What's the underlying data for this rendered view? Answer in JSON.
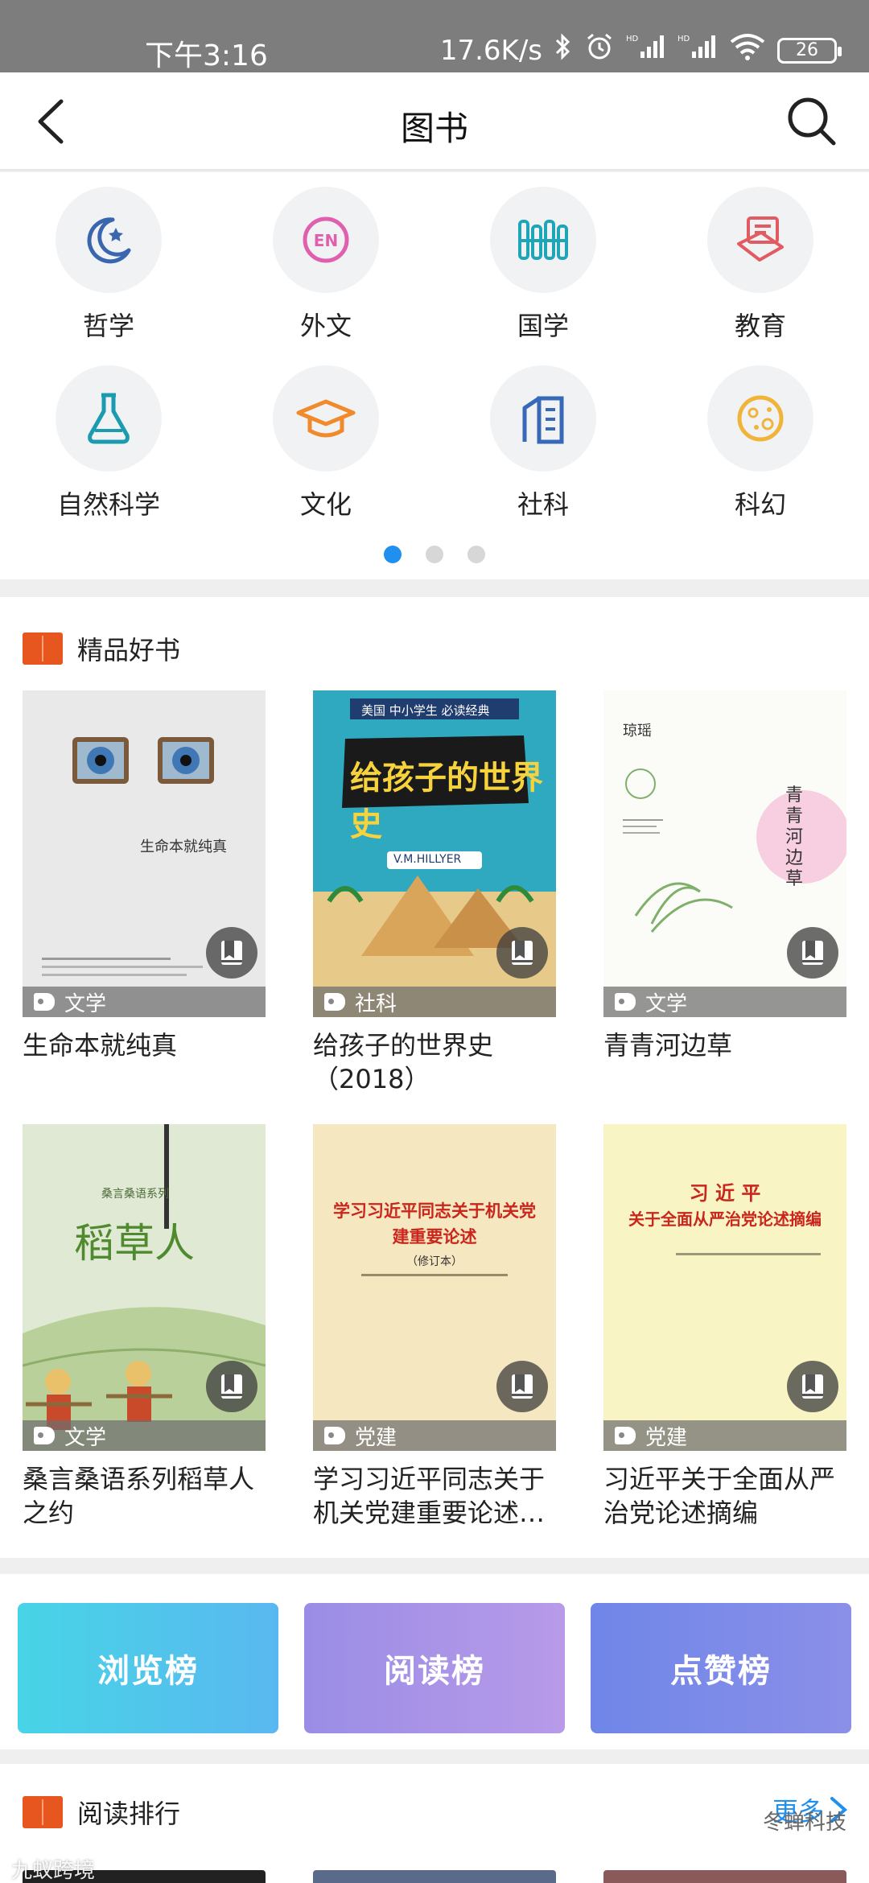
{
  "status_bar": {
    "time": "下午3:16",
    "net_speed": "17.6K/s",
    "battery": "26"
  },
  "header": {
    "title": "图书"
  },
  "categories": [
    {
      "label": "哲学",
      "icon": "moon-star-icon",
      "color": "#3a66b0"
    },
    {
      "label": "外文",
      "icon": "eng-badge-icon",
      "color": "#e060b0"
    },
    {
      "label": "国学",
      "icon": "bamboo-scroll-icon",
      "color": "#1fa5b8"
    },
    {
      "label": "教育",
      "icon": "book-stack-icon",
      "color": "#e25b63"
    },
    {
      "label": "自然科学",
      "icon": "flask-icon",
      "color": "#1b9bb0"
    },
    {
      "label": "文化",
      "icon": "graduation-cap-icon",
      "color": "#f08a2a"
    },
    {
      "label": "社科",
      "icon": "building-doc-icon",
      "color": "#3868b8"
    },
    {
      "label": "科幻",
      "icon": "planet-icon",
      "color": "#f0b43a"
    }
  ],
  "pager": {
    "pages": 3,
    "active": 0
  },
  "featured": {
    "title": "精品好书",
    "books": [
      {
        "title": "生命本就纯真",
        "tag": "文学",
        "cover_title": "生命本就纯真"
      },
      {
        "title": "给孩子的世界史（2018）",
        "tag": "社科",
        "cover_banner": "美国 中小学生 必读经典",
        "cover_title": "给孩子的世界史",
        "cover_author": "V.M.HILLYER"
      },
      {
        "title": "青青河边草",
        "tag": "文学",
        "cover_title": "青青河边草",
        "cover_author": "琼瑶"
      },
      {
        "title": "桑言桑语系列稻草人之约",
        "tag": "文学",
        "cover_series": "桑言桑语系列",
        "cover_title": "稻草人"
      },
      {
        "title": "学习习近平同志关于机关党建重要论述…",
        "tag": "党建",
        "cover_title": "学习习近平同志关于机关党建重要论述",
        "cover_sub": "（修订本）"
      },
      {
        "title": "习近平关于全面从严治党论述摘编",
        "tag": "党建",
        "cover_title": "习 近 平",
        "cover_sub": "关于全面从严治党论述摘编"
      }
    ]
  },
  "rank_buttons": [
    {
      "label": "浏览榜",
      "from": "#47d4e6",
      "to": "#5ab8f0"
    },
    {
      "label": "阅读榜",
      "from": "#9a8de6",
      "to": "#b89ae8"
    },
    {
      "label": "点赞榜",
      "from": "#6f86e8",
      "to": "#8b8fe8"
    }
  ],
  "reading_rank": {
    "title": "阅读排行",
    "more": "更多"
  },
  "watermarks": {
    "left": "九蚁跨境",
    "right": "冬蝉科技"
  }
}
